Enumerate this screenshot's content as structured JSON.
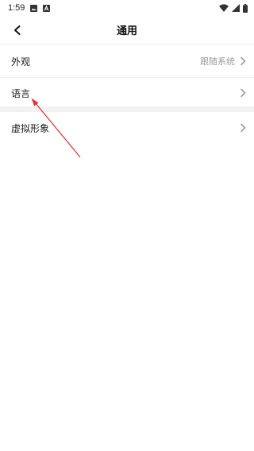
{
  "status_bar": {
    "time": "1:59",
    "icons": [
      "image-icon",
      "a-notification-icon",
      "wifi-icon",
      "signal-icon",
      "battery-icon"
    ]
  },
  "header": {
    "title": "通用",
    "back_icon": "chevron-left-icon"
  },
  "settings": {
    "appearance": {
      "label": "外观",
      "value": "跟随系统",
      "icon": "chevron-right-icon"
    },
    "language": {
      "label": "语言",
      "icon": "chevron-right-icon"
    },
    "avatar": {
      "label": "虚拟形象",
      "icon": "chevron-right-icon"
    }
  },
  "annotation": {
    "color": "#e0353a",
    "icon": "red-arrow-pointer"
  }
}
